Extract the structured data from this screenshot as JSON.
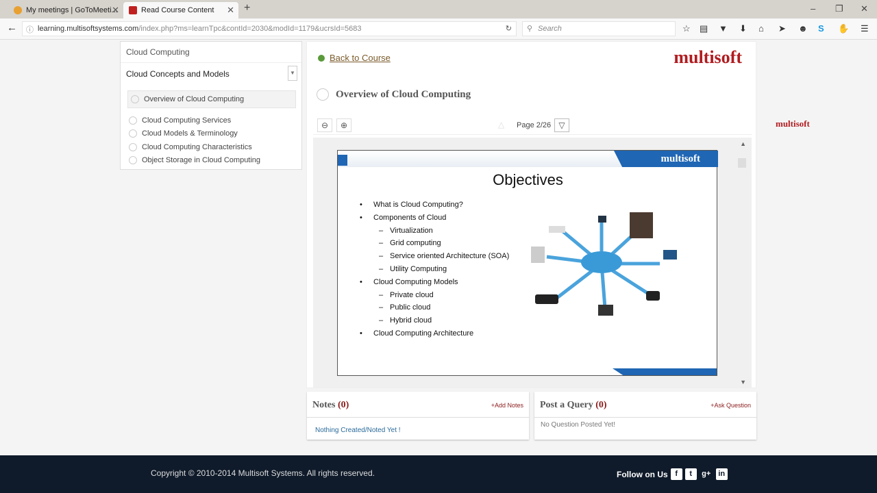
{
  "browser": {
    "tabs": [
      {
        "title": "My meetings | GoToMeeti..."
      },
      {
        "title": "Read Course Content"
      }
    ],
    "url_domain": "learning.multisoftsystems.com",
    "url_path": "/index.php?ms=learnTpc&contId=2030&modId=1179&ucrsId=5683",
    "search_placeholder": "Search"
  },
  "sidebar": {
    "course": "Cloud Computing",
    "module": "Cloud Concepts and Models",
    "items": [
      {
        "label": "Overview of Cloud Computing"
      },
      {
        "label": "Cloud Computing Services"
      },
      {
        "label": "Cloud Models & Terminology"
      },
      {
        "label": "Cloud Computing Characteristics"
      },
      {
        "label": "Object Storage in Cloud Computing"
      }
    ]
  },
  "main": {
    "back": "Back to Course",
    "logo": "multisoft",
    "topic": "Overview of Cloud Computing",
    "page": "Page 2/26"
  },
  "side_logo": "multisoft",
  "slide": {
    "logo": "multisoft",
    "title": "Objectives",
    "bullets": [
      {
        "t": "What is Cloud Computing?",
        "l": 1
      },
      {
        "t": "Components of Cloud",
        "l": 1
      },
      {
        "t": "Virtualization",
        "l": 2
      },
      {
        "t": "Grid computing",
        "l": 2
      },
      {
        "t": "Service oriented Architecture (SOA)",
        "l": 2
      },
      {
        "t": "Utility Computing",
        "l": 2
      },
      {
        "t": "Cloud Computing Models",
        "l": 1
      },
      {
        "t": "Private cloud",
        "l": 2
      },
      {
        "t": "Public cloud",
        "l": 2
      },
      {
        "t": "Hybrid cloud",
        "l": 2
      },
      {
        "t": "Cloud Computing Architecture",
        "l": 1
      }
    ]
  },
  "notes": {
    "title": "Notes",
    "count": "(0)",
    "add": "+Add Notes",
    "empty": "Nothing Created/Noted Yet !"
  },
  "query": {
    "title": "Post a Query",
    "count": "(0)",
    "add": "+Ask Question",
    "empty": "No Question Posted Yet!"
  },
  "footer": {
    "copyright": "Copyright © 2010-2014 Multisoft Systems. All rights reserved.",
    "follow": "Follow on Us"
  }
}
